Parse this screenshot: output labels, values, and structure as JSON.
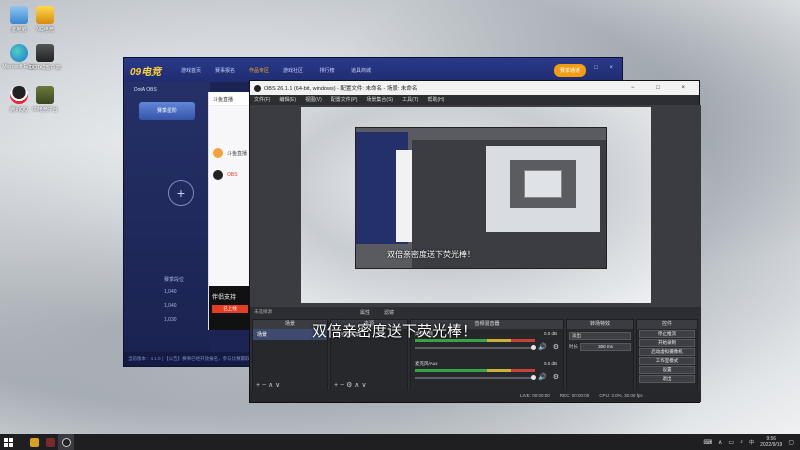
{
  "desktop": {
    "icons": [
      {
        "label": "此电脑"
      },
      {
        "label": "NG电竞"
      },
      {
        "label": "Microsoft Edge"
      },
      {
        "label": "DOTA2客户端"
      },
      {
        "label": "腾讯QQ"
      },
      {
        "label": "09电竞平台"
      }
    ]
  },
  "game_window": {
    "logo": "09电竞",
    "nav": [
      "游戏首页",
      "赛事报名",
      "作品专区",
      "游戏社区",
      "排行榜",
      "道具商城"
    ],
    "vip": "赛季通道",
    "controls": "− □ ×",
    "game_label": "DotA OBS",
    "season_label": "赛季星阶",
    "add_symbol": "+",
    "rank_title": "赛季段位",
    "rank_values": [
      "1,040",
      "1,040",
      "1,030"
    ],
    "status": "当前版本：4.1.0  |  【公告】赛事已经开放报名，参与比赛赢取奖励"
  },
  "douyu": {
    "header": "斗鱼直播",
    "rows": [
      "斗鱼直播",
      "OBS"
    ],
    "banner_title": "伴侣支持",
    "banner_btn": "已上线"
  },
  "obs": {
    "title": "OBS 26.1.1 (64-bit, windows) - 配置文件: 未命名 - 场景: 未命名",
    "window_controls": "− □ ×",
    "menu": [
      "文件(F)",
      "编辑(E)",
      "视图(V)",
      "配置文件(P)",
      "场景集合(S)",
      "工具(T)",
      "帮助(H)"
    ],
    "preview_caption": "双倍亲密度送下荧光棒！",
    "preview_bar": [
      "属性",
      "滤镜"
    ],
    "source_selected": "未选择源",
    "docks": {
      "scenes": "场景",
      "scene_item": "场景",
      "sources": "来源",
      "source_item": "显示器采集",
      "mixer": "音频混音器",
      "mixer_rows": [
        {
          "name": "桌面音频",
          "db": "0.0 dB"
        },
        {
          "name": "麦克风/Aux",
          "db": "0.0 dB"
        }
      ],
      "transitions": "转场特效",
      "transition_value": "淡出",
      "duration_label": "时长",
      "duration_value": "300 ms",
      "controls": "控件",
      "control_buttons": [
        "停止推流",
        "开始录制",
        "启动虚拟摄像机",
        "工作室模式",
        "设置",
        "退出"
      ]
    },
    "status": [
      "LIVE: 00:00:00",
      "REC: 00:00:00",
      "CPU: 3.0%, 30.00 fps"
    ]
  },
  "overlay_caption": "双倍亲密度送下荧光棒！",
  "taskbar": {
    "time": "9:56",
    "date": "2022/9/19",
    "lang": "中"
  }
}
